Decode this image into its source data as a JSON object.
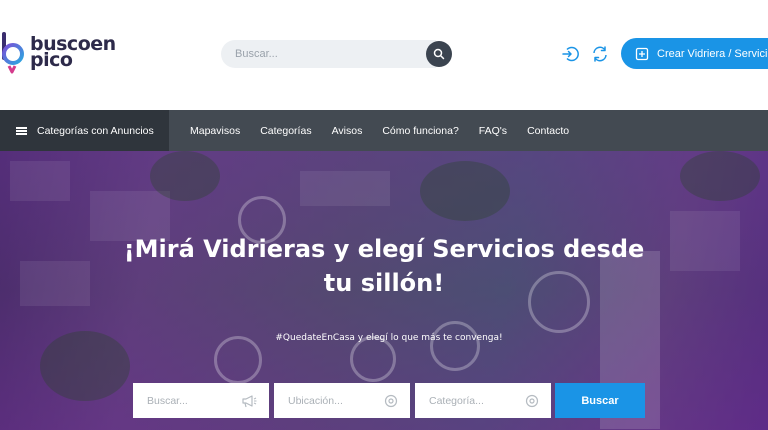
{
  "header": {
    "logo": {
      "line1": "buscoen",
      "line2": "pico"
    },
    "search": {
      "placeholder": "Buscar..."
    },
    "create_button_label": "Crear Vidriera / Servicio"
  },
  "nav": {
    "categories_label": "Categorías con Anuncios",
    "items": [
      "Mapavisos",
      "Categorías",
      "Avisos",
      "Cómo funciona?",
      "FAQ's",
      "Contacto"
    ]
  },
  "hero": {
    "title_line1": "¡Mirá Vidrieras y elegí Servicios desde",
    "title_line2": "tu sillón!",
    "subtitle": "#QuedateEnCasa y elegí lo que más te convenga!",
    "search_fields": [
      {
        "placeholder": "Buscar...",
        "icon": "megaphone-icon"
      },
      {
        "placeholder": "Ubicación...",
        "icon": "target-icon"
      },
      {
        "placeholder": "Categoría...",
        "icon": "target-icon"
      }
    ],
    "search_button_label": "Buscar"
  },
  "colors": {
    "accent": "#1a94e6",
    "nav": "#434a52",
    "nav_dark": "#2f353c",
    "logo_text": "#2d2a4a"
  }
}
